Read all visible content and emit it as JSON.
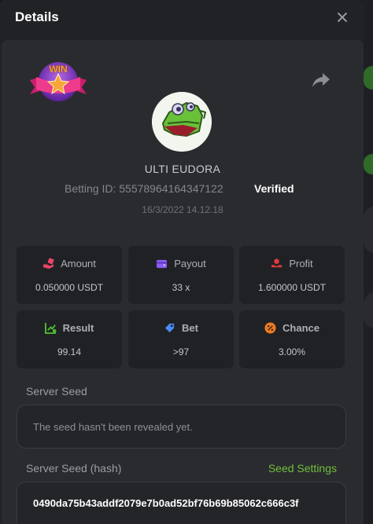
{
  "modal": {
    "title": "Details"
  },
  "user": {
    "name": "ULTI EUDORA"
  },
  "bet": {
    "betting_id": "Betting ID: 55578964164347122",
    "verified": "Verified",
    "date": "16/3/2022 14.12.18"
  },
  "badge": {
    "text": "WIN"
  },
  "stats": [
    {
      "label": "Amount",
      "value": "0.050000 USDT",
      "icon": "coins-hand-icon",
      "color": "#e94467"
    },
    {
      "label": "Payout",
      "value": "33 x",
      "icon": "wallet-icon",
      "color": "#8b5cf6"
    },
    {
      "label": "Profit",
      "value": "1.600000 USDT",
      "icon": "hand-coin-icon",
      "color": "#e03b3b"
    },
    {
      "label": "Result",
      "value": "99.14",
      "icon": "chart-up-icon",
      "color": "#4cbb32"
    },
    {
      "label": "Bet",
      "value": ">97",
      "icon": "tag-icon",
      "color": "#4a8af4"
    },
    {
      "label": "Chance",
      "value": "3.00%",
      "icon": "percent-icon",
      "color": "#f07a1e"
    }
  ],
  "server_seed": {
    "label": "Server Seed",
    "value": "The seed hasn't been revealed yet."
  },
  "server_seed_hash": {
    "label": "Server Seed (hash)",
    "settings_link": "Seed Settings",
    "value": "0490da75b43addf2079e7b0ad52bf76b69b85062c666c3f"
  }
}
